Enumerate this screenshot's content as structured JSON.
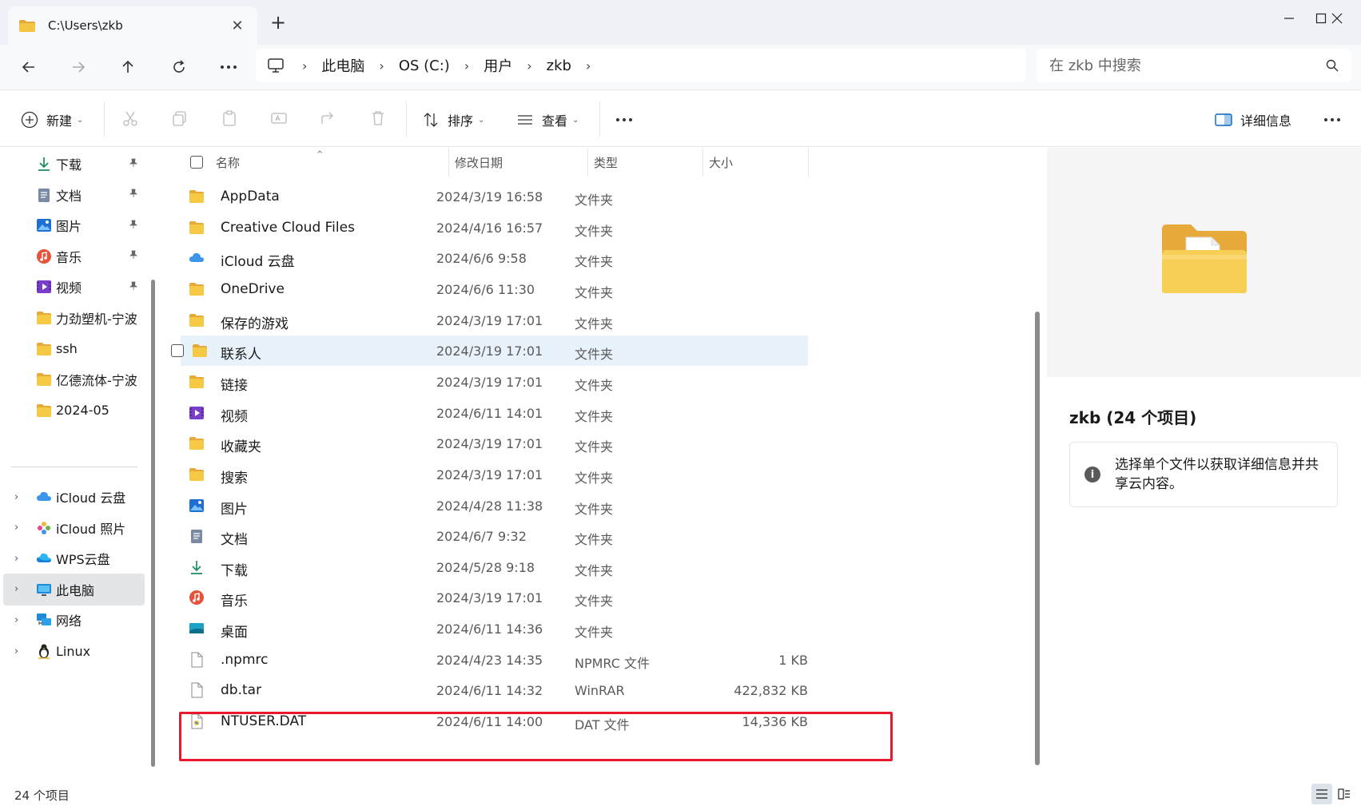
{
  "tab": {
    "title": "C:\\Users\\zkb",
    "close": "✕"
  },
  "new_tab": "+",
  "address": {
    "crumbs": [
      "此电脑",
      "OS (C:)",
      "用户",
      "zkb"
    ]
  },
  "search": {
    "placeholder": "在 zkb 中搜索"
  },
  "toolbar": {
    "new_label": "新建",
    "sort_label": "排序",
    "view_label": "查看",
    "more": "···",
    "details_label": "详细信息",
    "more_right": "···"
  },
  "sidebar": {
    "quick": [
      {
        "label": "下载",
        "icon": "download-icon",
        "pinned": true
      },
      {
        "label": "文档",
        "icon": "document-icon",
        "pinned": true
      },
      {
        "label": "图片",
        "icon": "pictures-icon",
        "pinned": true
      },
      {
        "label": "音乐",
        "icon": "music-icon",
        "pinned": true
      },
      {
        "label": "视频",
        "icon": "video-icon",
        "pinned": true
      },
      {
        "label": "力劲塑机-宁波",
        "icon": "folder-icon",
        "pinned": false
      },
      {
        "label": "ssh",
        "icon": "folder-icon",
        "pinned": false
      },
      {
        "label": "亿德流体-宁波",
        "icon": "folder-icon",
        "pinned": false
      },
      {
        "label": "2024-05",
        "icon": "folder-icon",
        "pinned": false
      }
    ],
    "locations": [
      {
        "label": "iCloud 云盘",
        "icon": "icloud-drive-icon"
      },
      {
        "label": "iCloud 照片",
        "icon": "icloud-photos-icon"
      },
      {
        "label": "WPS云盘",
        "icon": "wps-cloud-icon"
      },
      {
        "label": "此电脑",
        "icon": "this-pc-icon",
        "selected": true
      },
      {
        "label": "网络",
        "icon": "network-icon"
      },
      {
        "label": "Linux",
        "icon": "linux-icon"
      }
    ]
  },
  "columns": {
    "name": "名称",
    "modified": "修改日期",
    "type": "类型",
    "size": "大小"
  },
  "files": [
    {
      "name": "AppData",
      "modified": "2024/3/19 16:58",
      "type": "文件夹",
      "size": "",
      "icon": "folder-icon"
    },
    {
      "name": "Creative Cloud Files",
      "modified": "2024/4/16 16:57",
      "type": "文件夹",
      "size": "",
      "icon": "folder-icon"
    },
    {
      "name": "iCloud 云盘",
      "modified": "2024/6/6 9:58",
      "type": "文件夹",
      "size": "",
      "icon": "icloud-drive-icon"
    },
    {
      "name": "OneDrive",
      "modified": "2024/6/6 11:30",
      "type": "文件夹",
      "size": "",
      "icon": "folder-icon"
    },
    {
      "name": "保存的游戏",
      "modified": "2024/3/19 17:01",
      "type": "文件夹",
      "size": "",
      "icon": "folder-icon"
    },
    {
      "name": "联系人",
      "modified": "2024/3/19 17:01",
      "type": "文件夹",
      "size": "",
      "icon": "folder-icon",
      "hover": true
    },
    {
      "name": "链接",
      "modified": "2024/3/19 17:01",
      "type": "文件夹",
      "size": "",
      "icon": "folder-icon"
    },
    {
      "name": "视频",
      "modified": "2024/6/11 14:01",
      "type": "文件夹",
      "size": "",
      "icon": "video-icon"
    },
    {
      "name": "收藏夹",
      "modified": "2024/3/19 17:01",
      "type": "文件夹",
      "size": "",
      "icon": "folder-icon"
    },
    {
      "name": "搜索",
      "modified": "2024/3/19 17:01",
      "type": "文件夹",
      "size": "",
      "icon": "folder-icon"
    },
    {
      "name": "图片",
      "modified": "2024/4/28 11:38",
      "type": "文件夹",
      "size": "",
      "icon": "pictures-icon"
    },
    {
      "name": "文档",
      "modified": "2024/6/7 9:32",
      "type": "文件夹",
      "size": "",
      "icon": "document-icon"
    },
    {
      "name": "下载",
      "modified": "2024/5/28 9:18",
      "type": "文件夹",
      "size": "",
      "icon": "download-icon"
    },
    {
      "name": "音乐",
      "modified": "2024/3/19 17:01",
      "type": "文件夹",
      "size": "",
      "icon": "music-icon"
    },
    {
      "name": "桌面",
      "modified": "2024/6/11 14:36",
      "type": "文件夹",
      "size": "",
      "icon": "desktop-icon"
    },
    {
      "name": ".npmrc",
      "modified": "2024/4/23 14:35",
      "type": "NPMRC 文件",
      "size": "1 KB",
      "icon": "file-icon"
    },
    {
      "name": "db.tar",
      "modified": "2024/6/11 14:32",
      "type": "WinRAR",
      "size": "422,832 KB",
      "icon": "file-icon"
    },
    {
      "name": "NTUSER.DAT",
      "modified": "2024/6/11 14:00",
      "type": "DAT 文件",
      "size": "14,336 KB",
      "icon": "dat-file-icon"
    }
  ],
  "details": {
    "title": "zkb (24 个项目)",
    "info": "选择单个文件以获取详细信息并共享云内容。"
  },
  "status": {
    "count": "24 个项目"
  },
  "colors": {
    "folder": "#f4c542",
    "folder_dark": "#e8a93b",
    "accent": "#0067c0",
    "highlight_box": "#e8192c"
  }
}
